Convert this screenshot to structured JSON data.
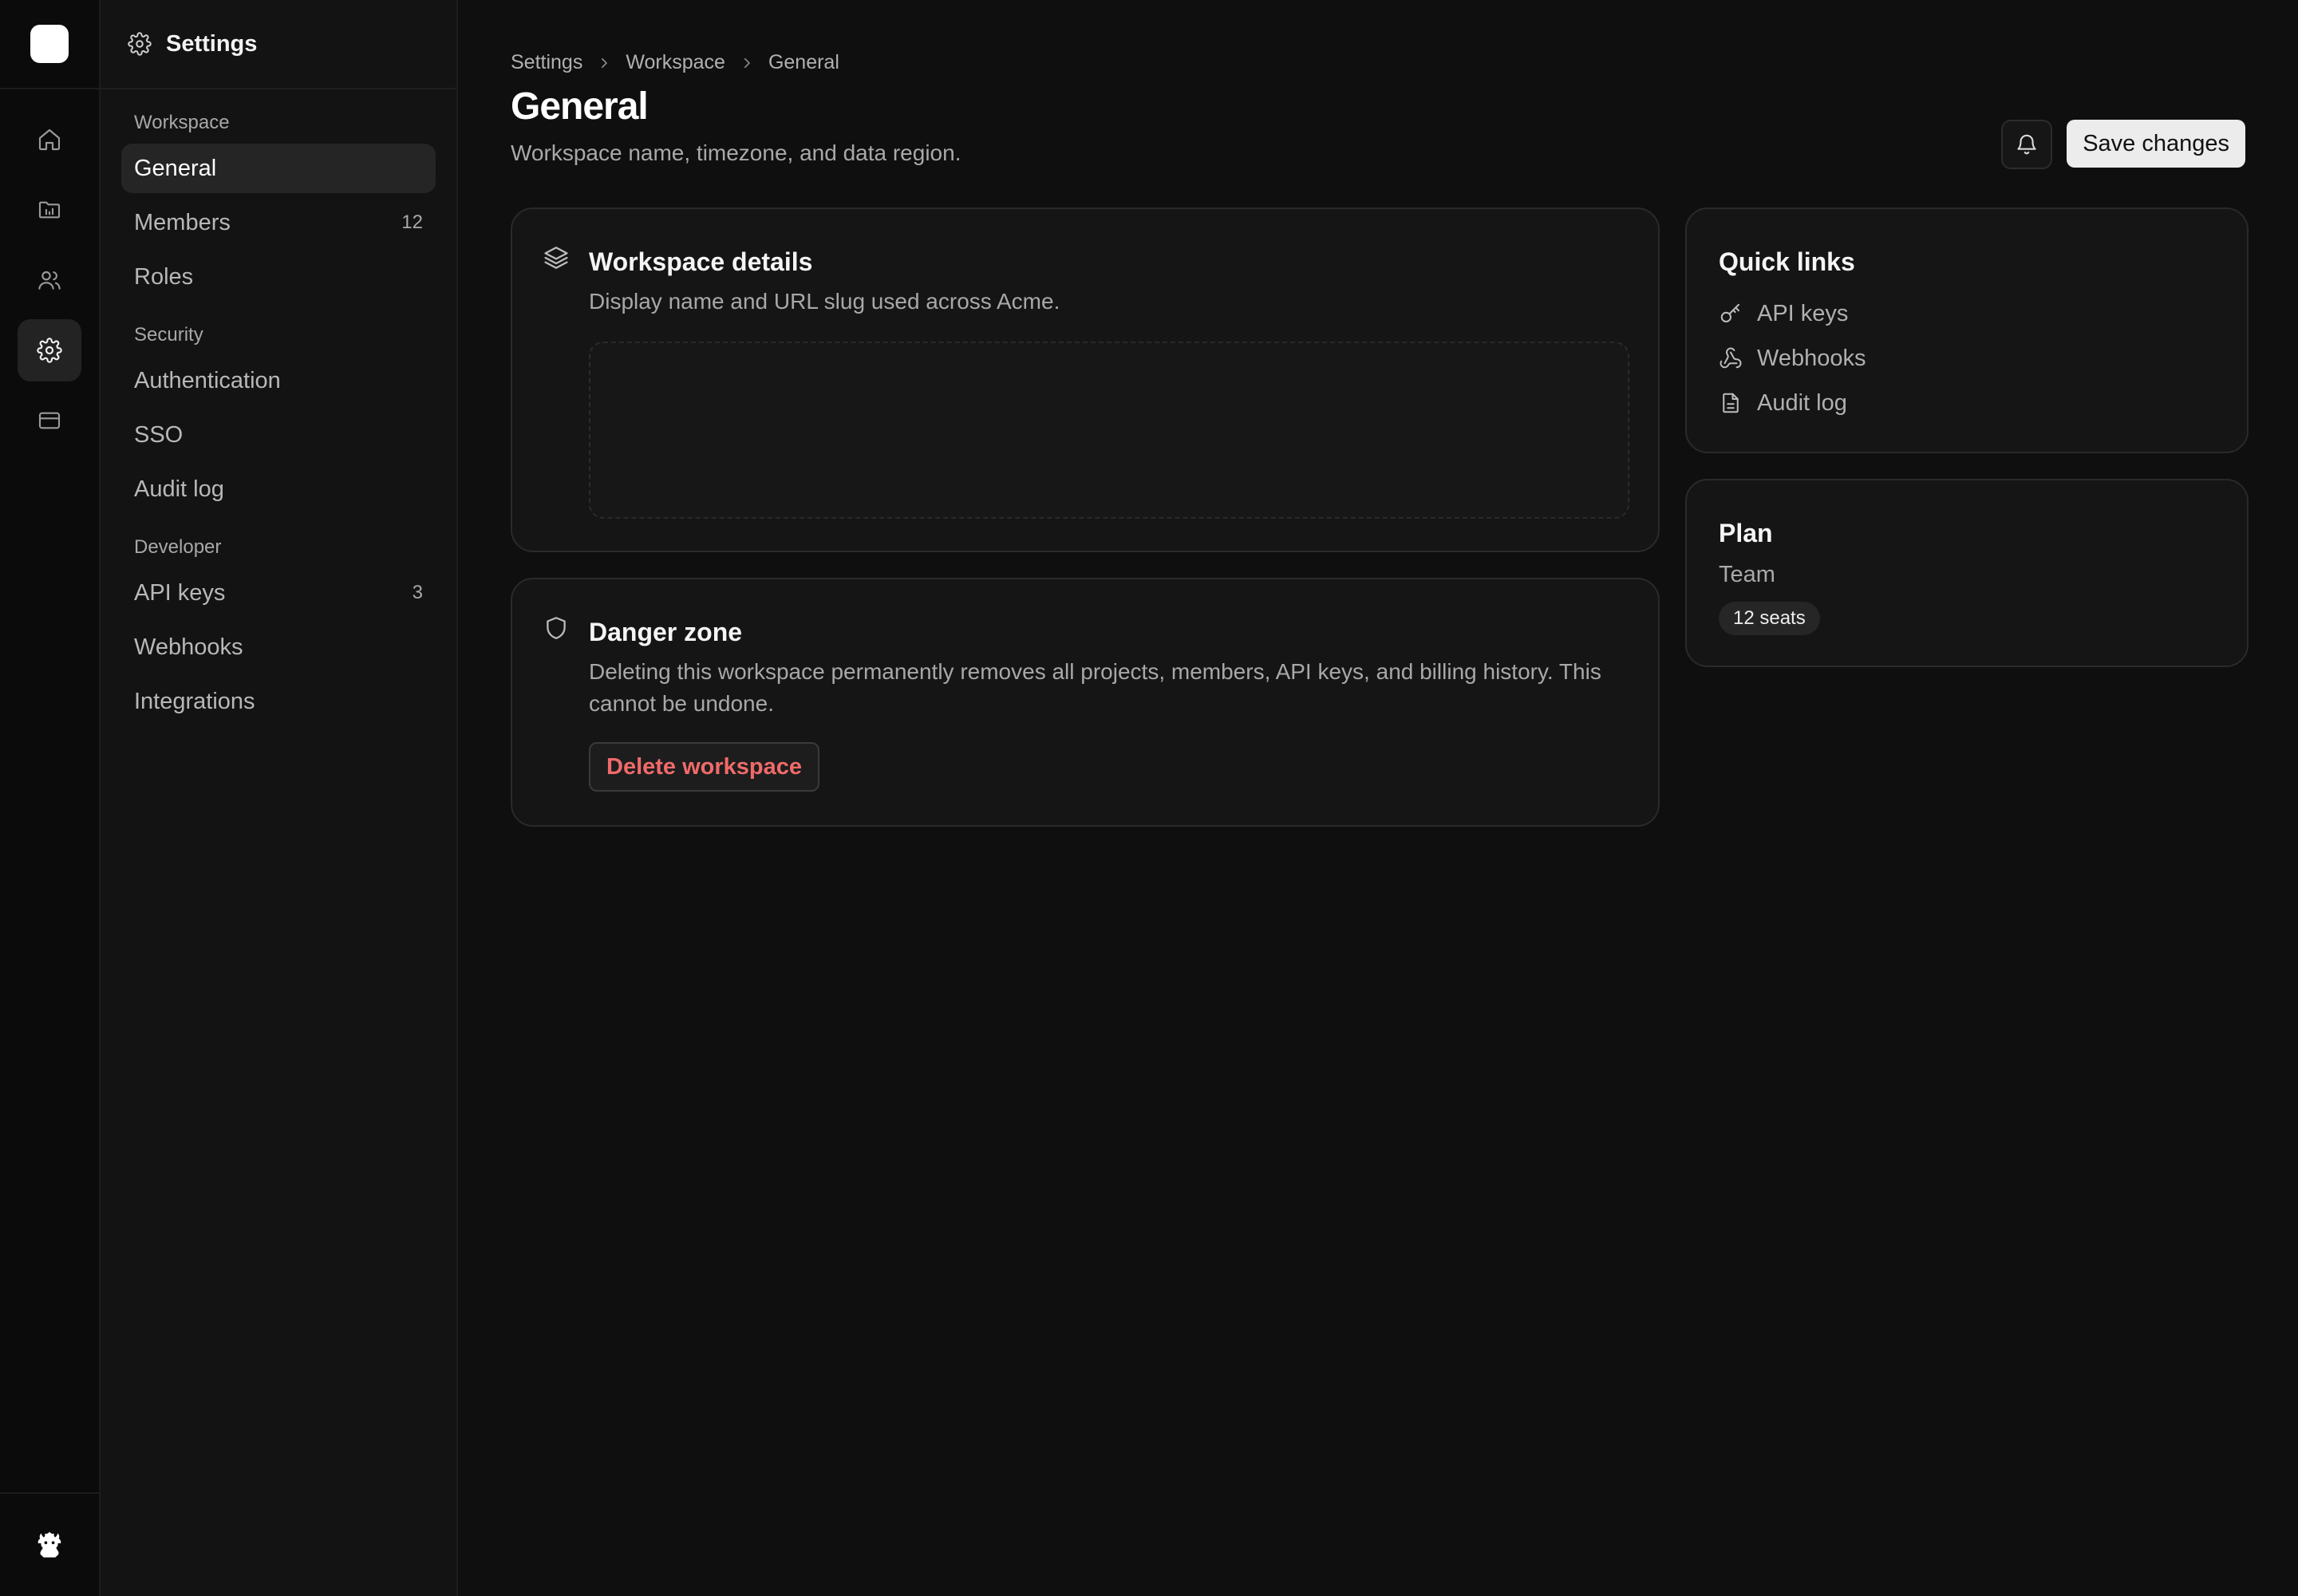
{
  "rail": {
    "items": [
      {
        "name": "home-icon"
      },
      {
        "name": "projects-icon"
      },
      {
        "name": "users-icon"
      },
      {
        "name": "gear-icon",
        "active": true
      },
      {
        "name": "billing-icon"
      }
    ]
  },
  "sidebar": {
    "title": "Settings",
    "groups": [
      {
        "label": "Workspace",
        "items": [
          {
            "label": "General",
            "active": true,
            "count": ""
          },
          {
            "label": "Members",
            "count": "12"
          },
          {
            "label": "Roles",
            "count": ""
          }
        ]
      },
      {
        "label": "Security",
        "items": [
          {
            "label": "Authentication",
            "count": ""
          },
          {
            "label": "SSO",
            "count": ""
          },
          {
            "label": "Audit log",
            "count": ""
          }
        ]
      },
      {
        "label": "Developer",
        "items": [
          {
            "label": "API keys",
            "count": "3"
          },
          {
            "label": "Webhooks",
            "count": ""
          },
          {
            "label": "Integrations",
            "count": ""
          }
        ]
      }
    ]
  },
  "header": {
    "breadcrumb": [
      "Settings",
      "Workspace",
      "General"
    ],
    "title": "General",
    "subtitle": "Workspace name, timezone, and data region.",
    "save_label": "Save changes"
  },
  "details_card": {
    "title": "Workspace details",
    "description": "Display name and URL slug used across Acme."
  },
  "danger_card": {
    "title": "Danger zone",
    "description": "Deleting this workspace permanently removes all projects, members, API keys, and billing history. This cannot be undone.",
    "button_label": "Delete workspace",
    "button_color": "#f06a6a"
  },
  "quick_links": {
    "title": "Quick links",
    "items": [
      {
        "label": "API keys",
        "icon": "key-icon"
      },
      {
        "label": "Webhooks",
        "icon": "webhook-icon"
      },
      {
        "label": "Audit log",
        "icon": "document-icon"
      }
    ]
  },
  "plan": {
    "title": "Plan",
    "name": "Team",
    "seats": "12 seats"
  }
}
